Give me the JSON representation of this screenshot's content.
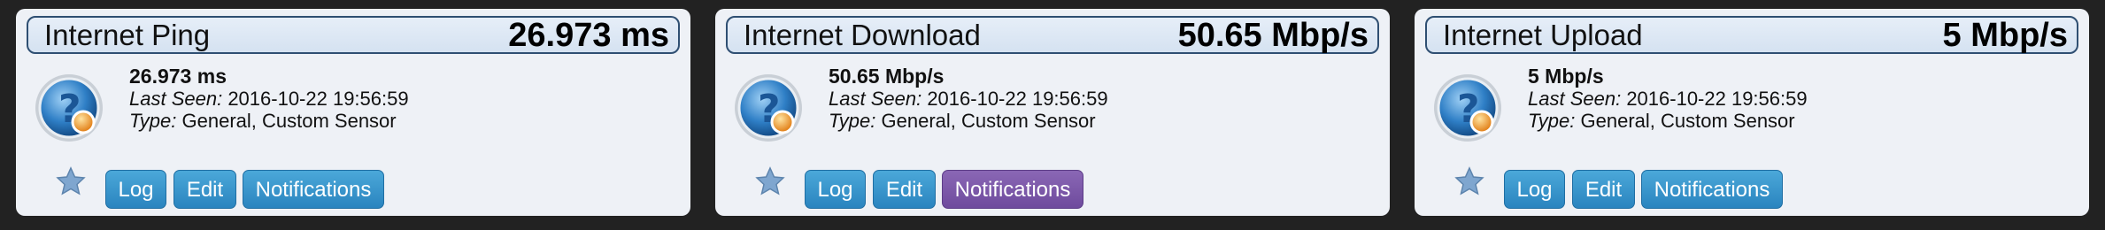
{
  "cards": [
    {
      "title": "Internet Ping",
      "value_header": "26.973 ms",
      "value": "26.973 ms",
      "last_seen_label": "Last Seen:",
      "last_seen": "2016-10-22 19:56:59",
      "type_label": "Type:",
      "type": "General, Custom Sensor",
      "buttons": {
        "log": "Log",
        "edit": "Edit",
        "notifications": "Notifications"
      },
      "notifications_active": false
    },
    {
      "title": "Internet Download",
      "value_header": "50.65 Mbp/s",
      "value": "50.65 Mbp/s",
      "last_seen_label": "Last Seen:",
      "last_seen": "2016-10-22 19:56:59",
      "type_label": "Type:",
      "type": "General, Custom Sensor",
      "buttons": {
        "log": "Log",
        "edit": "Edit",
        "notifications": "Notifications"
      },
      "notifications_active": true
    },
    {
      "title": "Internet Upload",
      "value_header": "5 Mbp/s",
      "value": "5 Mbp/s",
      "last_seen_label": "Last Seen:",
      "last_seen": "2016-10-22 19:56:59",
      "type_label": "Type:",
      "type": "General, Custom Sensor",
      "buttons": {
        "log": "Log",
        "edit": "Edit",
        "notifications": "Notifications"
      },
      "notifications_active": false
    }
  ],
  "icons": {
    "sensor": "globe-question-icon",
    "favorite": "star-icon"
  },
  "colors": {
    "button": "#2a84bf",
    "button_active": "#6e4b9d",
    "header_border": "#2f4f72"
  }
}
